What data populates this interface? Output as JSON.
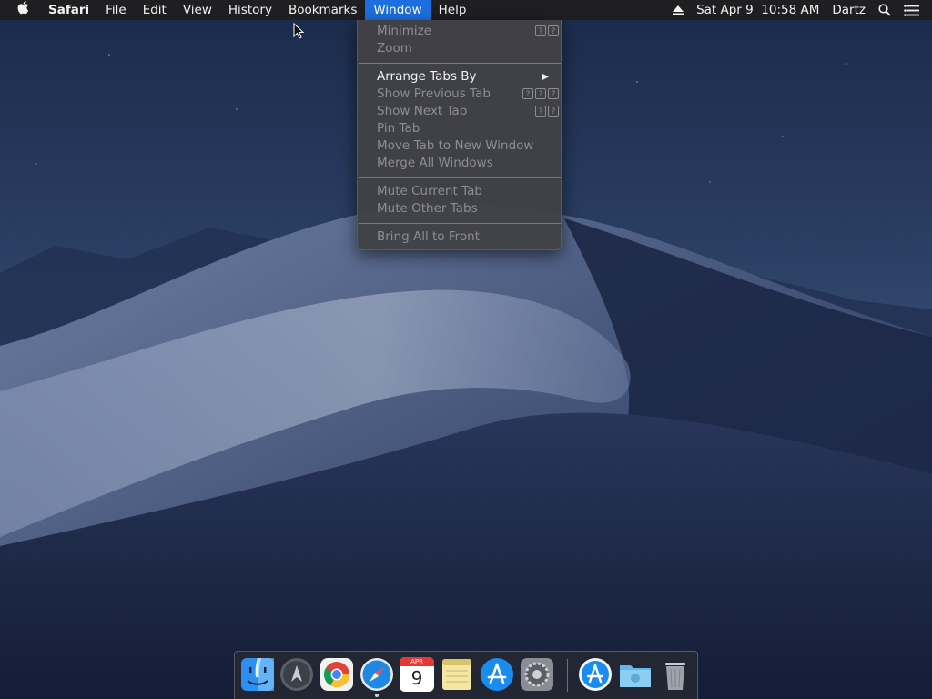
{
  "menubar": {
    "apple_icon": "apple-logo-icon",
    "app_name": "Safari",
    "menus": [
      {
        "label": "File"
      },
      {
        "label": "Edit"
      },
      {
        "label": "View"
      },
      {
        "label": "History"
      },
      {
        "label": "Bookmarks"
      },
      {
        "label": "Window",
        "active": true
      },
      {
        "label": "Help"
      }
    ],
    "status": {
      "eject_icon": "eject-icon",
      "datetime": "Sat Apr 9  10:58 AM",
      "user": "Dartz",
      "spotlight_icon": "spotlight-search-icon",
      "notification_icon": "notification-center-icon"
    }
  },
  "window_menu": {
    "minimize": "Minimize",
    "zoom": "Zoom",
    "arrange_tabs_by": "Arrange Tabs By",
    "show_previous_tab": "Show Previous Tab",
    "show_next_tab": "Show Next Tab",
    "pin_tab": "Pin Tab",
    "move_tab": "Move Tab to New Window",
    "merge_windows": "Merge All Windows",
    "mute_current": "Mute Current Tab",
    "mute_other": "Mute Other Tabs",
    "bring_all": "Bring All to Front",
    "shortcut_glyph": "?"
  },
  "dock": {
    "calendar_month": "APR",
    "calendar_day": "9",
    "items": [
      "Finder",
      "Launchpad",
      "Google Chrome",
      "Safari",
      "Calendar",
      "Notes",
      "App Store",
      "System Preferences",
      "Applications",
      "Downloads",
      "Trash"
    ]
  },
  "colors": {
    "menubar_bg": "#1f1f22",
    "menu_highlight": "#1d6fe0",
    "menu_bg": "#424246",
    "disabled_text": "#8d8d91"
  }
}
